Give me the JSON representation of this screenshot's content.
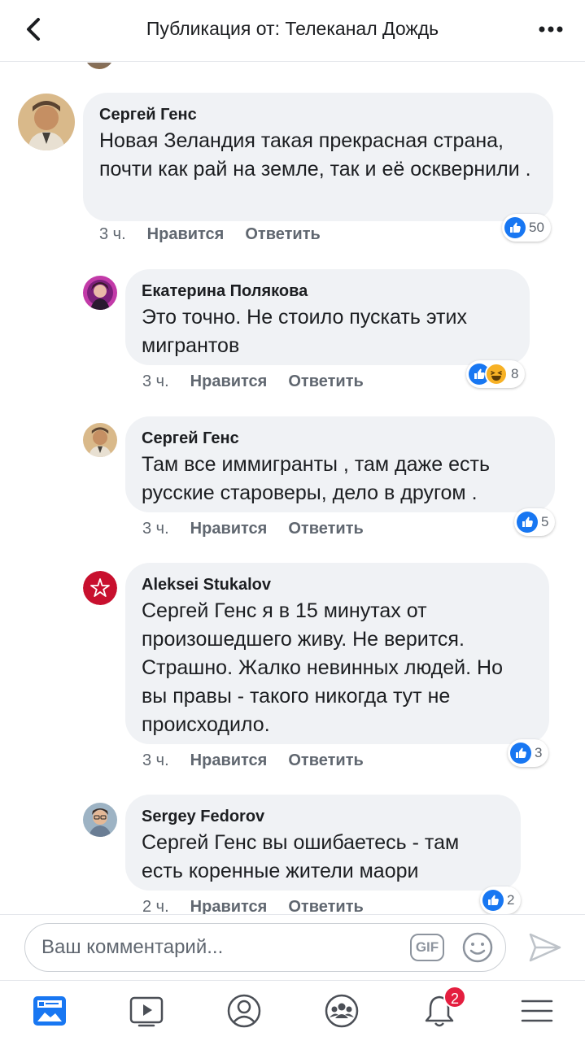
{
  "header": {
    "title": "Публикация от: Телеканал Дождь",
    "back_icon": "chevron-left-icon",
    "more_icon": "more-dots-icon"
  },
  "comments": [
    {
      "author": "Сергей Генс",
      "text": "Новая Зеландия такая прекрасная страна, почти как рай на земле, так и её осквернили .",
      "time": "3 ч.",
      "like_label": "Нравится",
      "reply_label": "Ответить",
      "reactions": [
        "like"
      ],
      "reaction_count": "50"
    },
    {
      "author": "Екатерина Полякова",
      "text": "Это точно. Не стоило пускать этих мигрантов",
      "time": "3 ч.",
      "like_label": "Нравится",
      "reply_label": "Ответить",
      "reactions": [
        "like",
        "haha"
      ],
      "reaction_count": "8"
    },
    {
      "author": "Сергей Генс",
      "text": "Там все иммигранты , там даже есть русские староверы, дело в другом .",
      "time": "3 ч.",
      "like_label": "Нравится",
      "reply_label": "Ответить",
      "reactions": [
        "like"
      ],
      "reaction_count": "5"
    },
    {
      "author": "Aleksei Stukalov",
      "text": "Сергей Генс я в 15 минутах от произошедшего живу. Не верится. Страшно. Жалко невинных людей. Но вы правы - такого никогда тут не происходило.",
      "time": "3 ч.",
      "like_label": "Нравится",
      "reply_label": "Ответить",
      "reactions": [
        "like"
      ],
      "reaction_count": "3"
    },
    {
      "author": "Sergey  Fedorov",
      "text": "Сергей Генс вы ошибаетесь - там есть коренные жители маори",
      "time": "2 ч.",
      "like_label": "Нравится",
      "reply_label": "Ответить",
      "reactions": [
        "like"
      ],
      "reaction_count": "2"
    }
  ],
  "composer": {
    "placeholder": "Ваш комментарий...",
    "gif_label": "GIF"
  },
  "tabbar": {
    "items": [
      "news-feed-icon",
      "watch-icon",
      "profile-icon",
      "groups-icon",
      "notifications-icon",
      "menu-icon"
    ],
    "notifications_badge": "2"
  },
  "colors": {
    "accent": "#1877f2",
    "bubble": "#f0f2f5",
    "badge": "#e41e3f"
  }
}
